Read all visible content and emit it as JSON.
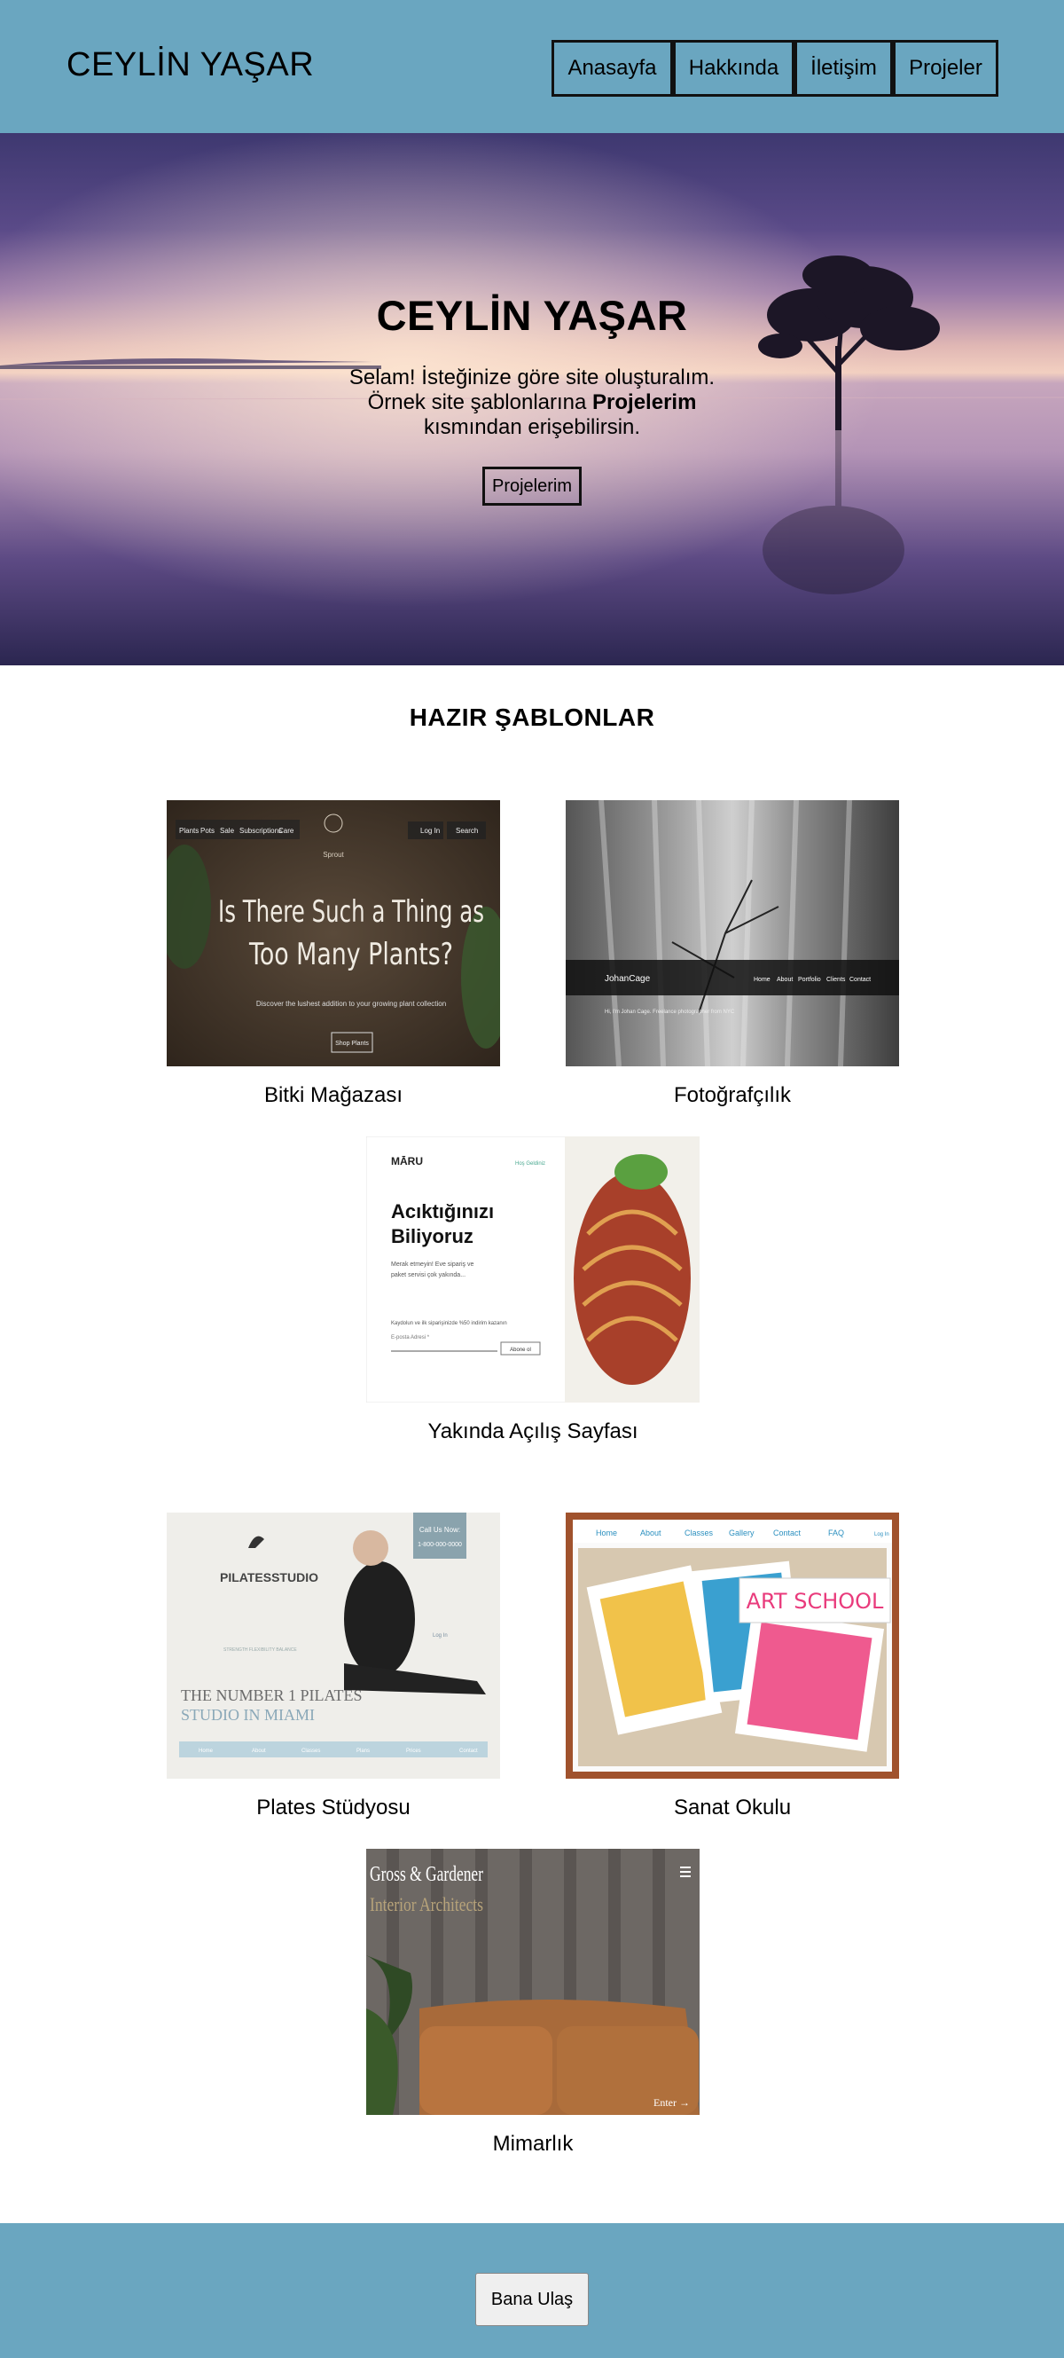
{
  "header": {
    "brand": "CEYLİN YAŞAR",
    "nav": [
      "Anasayfa",
      "Hakkında",
      "İletişim",
      "Projeler"
    ]
  },
  "hero": {
    "title": "CEYLİN YAŞAR",
    "line1": "Selam! İsteğinize göre site oluşturalım.",
    "line2_pre": "Örnek site şablonlarına ",
    "line2_bold": "Projelerim",
    "line3": "kısmından erişebilirsin.",
    "button": "Projelerim"
  },
  "templates": {
    "title": "HAZIR ŞABLONLAR",
    "items": [
      {
        "caption": "Bitki Mağazası",
        "thumb": {
          "nav": [
            "Plants",
            "Pots",
            "Sale",
            "Subscriptions",
            "Care"
          ],
          "logo": "Sprout",
          "login": "Log In",
          "search": "Search",
          "headline1": "Is There Such a Thing as",
          "headline2": "Too Many Plants?",
          "sub": "Discover the lushest addition to your growing plant collection",
          "button": "Shop Plants"
        }
      },
      {
        "caption": "Fotoğrafçılık",
        "thumb": {
          "name": "JohanCage",
          "nav": [
            "Home",
            "About",
            "Portfolio",
            "Clients",
            "Contact"
          ],
          "sub": "Hi, I'm Johan Cage. Freelance photographer from NYC"
        }
      },
      {
        "caption": "Yakında Açılış Sayfası",
        "thumb": {
          "logo": "MĀRU",
          "link": "Hoş Geldiniz",
          "headline1": "Acıktığınızı",
          "headline2": "Biliyoruz",
          "sub1": "Merak etmeyin! Eve sipariş ve",
          "sub2": "paket servisi çok yakında...",
          "offer": "Kaydolun ve ilk siparişinizde %50 indirim kazanın",
          "email": "E-posta Adresi *",
          "button": "Abone ol"
        }
      },
      {
        "caption": "Plates Stüdyosu",
        "thumb": {
          "logo": "PILATESSTUDIO",
          "call1": "Call Us Now:",
          "call2": "1-800-000-0000",
          "login": "Log In",
          "tag": "STRENGTH  FLEXIBILITY  BALANCE",
          "headline1": "THE NUMBER 1 PILATES",
          "headline2": "STUDIO IN MIAMI",
          "nav": [
            "Home",
            "About",
            "Classes",
            "Plans",
            "Prices",
            "Contact"
          ]
        }
      },
      {
        "caption": "Sanat Okulu",
        "thumb": {
          "nav": [
            "Home",
            "About",
            "Classes",
            "Gallery",
            "Contact",
            "FAQ"
          ],
          "login": "Log In",
          "sign": "ART SCHOOL"
        }
      },
      {
        "caption": "Mimarlık",
        "thumb": {
          "title1": "Gross & Gardener",
          "title2": "Interior Architects",
          "enter": "Enter →"
        }
      }
    ]
  },
  "footer": {
    "button": "Bana Ulaş"
  }
}
